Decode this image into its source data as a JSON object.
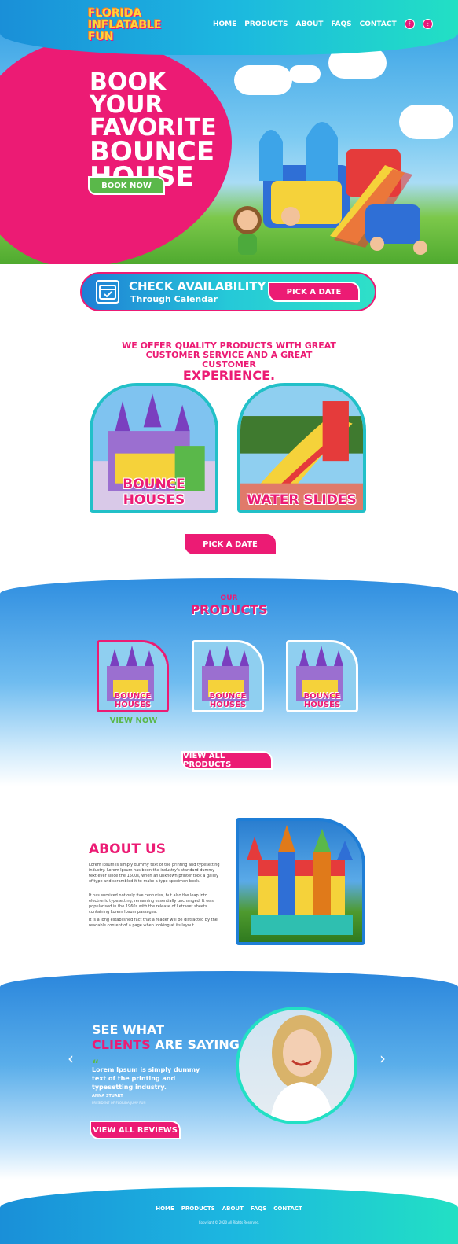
{
  "brand": {
    "logo_line1": "FLORIDA",
    "logo_line2": "INFLATABLE",
    "logo_line3": "FUN",
    "primary": "#ec1b74",
    "accent": "#22e0c4",
    "green": "#5ab84a"
  },
  "nav": {
    "items": [
      "HOME",
      "PRODUCTS",
      "ABOUT",
      "FAQS",
      "CONTACT"
    ],
    "social": [
      "facebook-icon",
      "twitter-icon"
    ]
  },
  "hero": {
    "title_line1": "BOOK YOUR",
    "title_line2": "FAVORITE",
    "title_line3": "BOUNCE",
    "title_line4": "HOUSE",
    "cta": "BOOK NOW"
  },
  "availability": {
    "title": "CHECK AVAILABILITY",
    "subtitle": "Through Calendar",
    "cta": "PICK A DATE"
  },
  "quality": {
    "line1": "WE OFFER QUALITY PRODUCTS WITH GREAT",
    "line2": "CUSTOMER SERVICE AND A GREAT CUSTOMER",
    "line3": "EXPERIENCE."
  },
  "categories": [
    {
      "label": "BOUNCE HOUSES"
    },
    {
      "label": "WATER SLIDES"
    }
  ],
  "pick_date_2": "PICK A DATE",
  "products": {
    "overline": "OUR",
    "title": "PRODUCTS",
    "items": [
      {
        "label": "BOUNCE HOUSES"
      },
      {
        "label": "BOUNCE HOUSES"
      },
      {
        "label": "BOUNCE HOUSES"
      }
    ],
    "view_now": "VIEW NOW",
    "view_all": "VIEW ALL PRODUCTS"
  },
  "about": {
    "title": "ABOUT US",
    "p1": "Lorem Ipsum is simply dummy text of the printing and typesetting industry. Lorem Ipsum has been the industry's standard dummy text ever since the 1500s, when an unknown printer took a galley of type and scrambled it to make a type specimen book.",
    "p2": "It has survived not only five centuries, but also the leap into electronic typesetting, remaining essentially unchanged. It was popularised in the 1960s with the release of Letraset sheets containing Lorem Ipsum passages.",
    "p3": "It is a long established fact that a reader will be distracted by the readable content of a page when looking at its layout."
  },
  "testimonials": {
    "title_line1": "SEE WHAT",
    "title_pink": "CLIENTS",
    "title_rest": "ARE SAYING",
    "quote_open": "“",
    "quote": "Lorem Ipsum is simply dummy text of the printing and typesetting industry.",
    "author": "ANNA STUART",
    "author_role": "PRESIDENT OF FLORIDA JUMP FUN",
    "cta": "VIEW ALL REVIEWS",
    "prev": "‹",
    "next": "›"
  },
  "footer": {
    "items": [
      "HOME",
      "PRODUCTS",
      "ABOUT",
      "FAQS",
      "CONTACT"
    ],
    "copyright": "Copyright © 2020 All Rights Reserved."
  }
}
